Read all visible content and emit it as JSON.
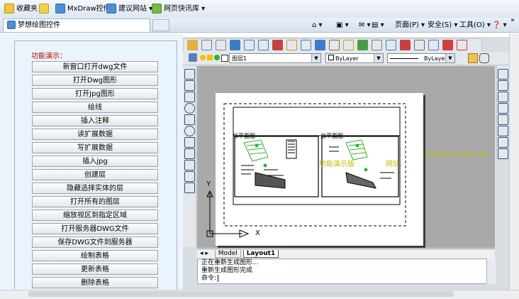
{
  "favorites_bar": {
    "favorites_label": "收藏夹",
    "items": [
      {
        "label": "MxDraw控件",
        "icon": "ie-page-icon"
      },
      {
        "label": "建议网站 ▾",
        "icon": "ie-page-icon"
      },
      {
        "label": "网页快讯库 ▾",
        "icon": "slice-icon"
      }
    ]
  },
  "tab": {
    "title": "梦想绘图控件"
  },
  "command_bar": {
    "items": [
      {
        "label": "页面(P) ▾"
      },
      {
        "label": "安全(S) ▾"
      },
      {
        "label": "工具(O) ▾"
      },
      {
        "label": "❓ ▾"
      }
    ],
    "overflow": "»"
  },
  "left_panel": {
    "heading": "功能演示：",
    "buttons": [
      "新窗口打开dwg文件",
      "打开Dwg图形",
      "打开Jpg图形",
      "绘线",
      "插入注释",
      "读扩展数据",
      "写扩展数据",
      "插入jpg",
      "创建层",
      "隐藏选择实体的层",
      "打开所有的图层",
      "缩放视区到指定区域",
      "打开服务器DWG文件",
      "保存DWG文件到服务器",
      "绘制表格",
      "更新表格",
      "删除表格"
    ]
  },
  "cad": {
    "layer_combo": "图层1",
    "color_combo": "ByLayer",
    "linetype_combo": "ByLayer",
    "layout_tabs": [
      "Model",
      "Layout1"
    ],
    "active_layout": "Layout1",
    "command_lines": [
      "正在重新生成图形...",
      "重新生成图形完成"
    ],
    "prompt": "命令:",
    "drawing_text": {
      "label_left": "总平面图",
      "label_right": "总平面图",
      "watermark_cn": "功能演示版",
      "watermark_site": "网站:",
      "watermark_url": "www.mxdraw.com",
      "ucs_y": "Y",
      "ucs_x": "X"
    },
    "accent_green": "#2db52d",
    "canvas_gray": "#a9a9a9"
  }
}
